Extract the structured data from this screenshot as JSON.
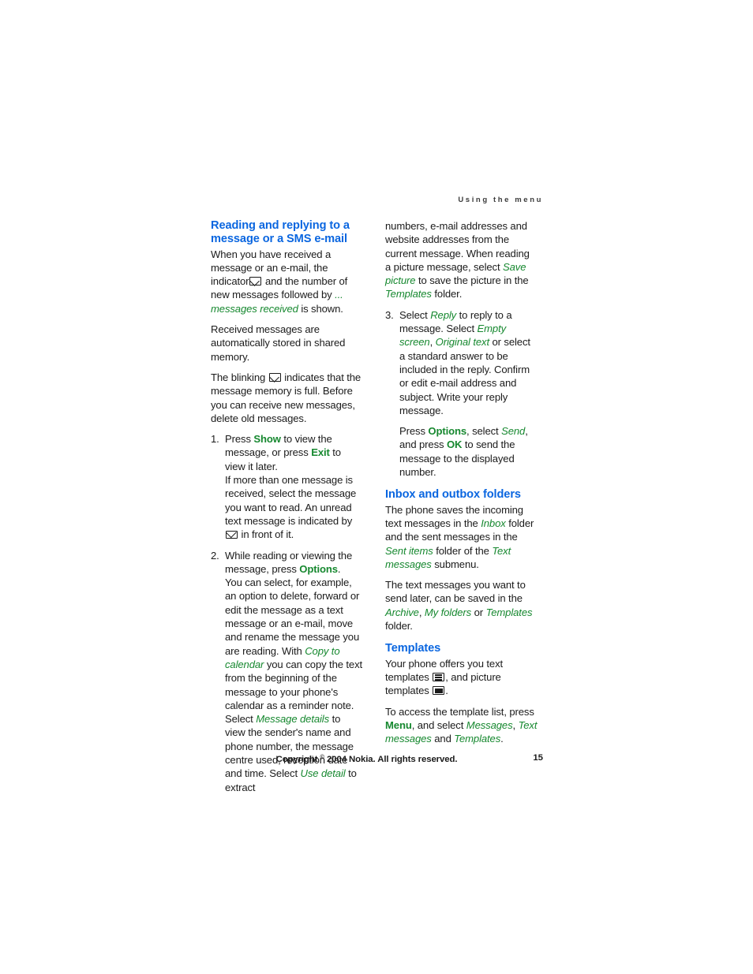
{
  "page": {
    "running_header": "Using the menu",
    "page_number": "15",
    "copyright": "Copyright",
    "copyright_symbol": "©",
    "copyright_rest": "2004 Nokia. All rights reserved.",
    "colors": {
      "heading_blue": "#0a66e0",
      "emphasis_green": "#16882f",
      "body_text": "#1b1b1b",
      "background": "#ffffff"
    }
  },
  "left_column": {
    "heading": "Reading and replying to a message or a SMS e-mail",
    "para1": {
      "a": "When you have received a message or an e-mail, the indicator",
      "icon": "envelope-icon",
      "b": "and the number of new messages followed by",
      "em": "... messages received",
      "c": "is shown."
    },
    "para2": "Received messages are automatically stored in shared memory.",
    "para3": {
      "a": "The blinking",
      "icon": "envelope-icon",
      "b": "indicates that the message memory is full. Before you can receive new messages, delete old messages."
    },
    "steps": [
      {
        "num": "1.",
        "paragraphs": [
          {
            "a": "Press",
            "key1": "Show",
            "b": "to view the message, or press",
            "key2": "Exit",
            "c": "to view it later."
          },
          {
            "a": "If more than one message is received, select the message you want to read. An unread text message is indicated by",
            "icon": "envelope-open-icon",
            "b": "in front of it."
          }
        ]
      },
      {
        "num": "2.",
        "paragraphs": [
          {
            "a": "While reading or viewing the message, press",
            "key1": "Options",
            "b": "."
          },
          {
            "a": "You can select, for example, an option to delete, forward or edit the message as a text message or an e-mail, move and rename the message you are reading. With",
            "em1": "Copy to calendar",
            "b": "you can copy the text from the beginning of the message to your phone's calendar as a reminder note. Select",
            "em2": "Message details",
            "c": "to view the sender's name and phone number, the message centre used, reception date and time. Select",
            "em3": "Use detail",
            "d": "to extract"
          }
        ]
      }
    ]
  },
  "right_column": {
    "continuation": {
      "a": "numbers, e-mail addresses and website addresses from the current message. When reading a picture message, select",
      "em1": "Save picture",
      "b": "to save the picture in the",
      "em2": "Templates",
      "c": "folder."
    },
    "step3": {
      "num": "3.",
      "paragraphs": [
        {
          "a": "Select",
          "em1": "Reply",
          "b": "to reply to a message. Select",
          "em2": "Empty screen",
          "c": ",",
          "em3": "Original text",
          "d": "or select a standard answer to be included in the reply. Confirm or edit e-mail address and subject. Write your reply message."
        },
        {
          "a": "Press",
          "key1": "Options",
          "b": ", select",
          "em1": "Send",
          "c": ", and press",
          "key2": "OK",
          "d": "to send the message to the displayed number."
        }
      ]
    },
    "inbox_section": {
      "heading": "Inbox and outbox folders",
      "para1": {
        "a": "The phone saves the incoming text messages in the",
        "em1": "Inbox",
        "b": "folder and the sent messages in the",
        "em2": "Sent items",
        "c": "folder of the",
        "em3": "Text messages",
        "d": "submenu."
      },
      "para2": {
        "a": "The text messages you want to send later, can be saved in the",
        "em1": "Archive",
        "b": ",",
        "em2": "My folders",
        "c": "or",
        "em3": "Templates",
        "d": "folder."
      }
    },
    "templates_section": {
      "heading": "Templates",
      "para1": {
        "a": "Your phone offers you text templates",
        "icon1": "text-template-icon",
        "b": ", and picture templates",
        "icon2": "picture-template-icon",
        "c": "."
      },
      "para2": {
        "a": "To access the template list, press",
        "key1": "Menu",
        "b": ", and select",
        "em1": "Messages",
        "c": ",",
        "em2": "Text messages",
        "d": "and",
        "em3": "Templates",
        "e": "."
      }
    }
  }
}
